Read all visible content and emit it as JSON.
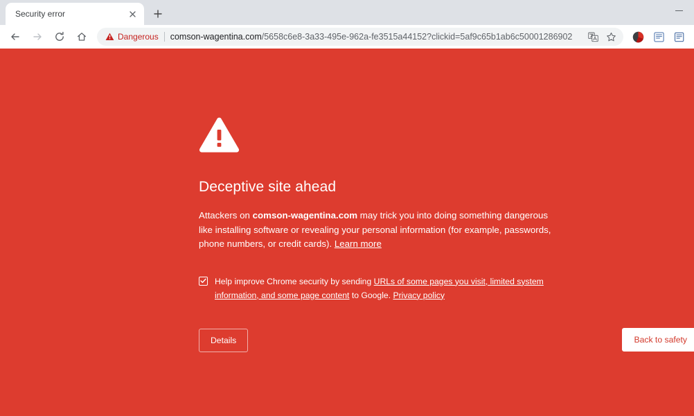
{
  "browser": {
    "tab": {
      "title": "Security error",
      "close_icon": "close-icon"
    },
    "new_tab_label": "+",
    "window_controls": {
      "minimize_label": "Minimize"
    },
    "nav": {
      "back_label": "Back",
      "forward_label": "Forward",
      "reload_label": "Reload",
      "home_label": "Home"
    },
    "omnibox": {
      "security_chip": "Dangerous",
      "security_icon": "warning-triangle-icon",
      "url_host": "comson-wagentina.com",
      "url_path": "/5658c6e8-3a33-495e-962a-fe3515a44152?clickid=5af9c65b1ab6c50001286902",
      "translate_icon": "translate-icon",
      "bookmark_icon": "star-icon"
    },
    "toolbar_extensions": [
      {
        "name": "profile-avatar-icon"
      },
      {
        "name": "reading-list-icon"
      },
      {
        "name": "extension-icon"
      }
    ]
  },
  "interstitial": {
    "icon": "warning-triangle-icon",
    "title": "Deceptive site ahead",
    "body_before": "Attackers on ",
    "body_host": "comson-wagentina.com",
    "body_after": " may trick you into doing something dangerous like installing software or revealing your personal information (for example, passwords, phone numbers, or credit cards). ",
    "learn_more": "Learn more",
    "optin": {
      "checked": true,
      "text_before": "Help improve Chrome security by sending ",
      "link_main": "URLs of some pages you visit, limited system information, and some page content",
      "text_middle": " to Google. ",
      "link_privacy": "Privacy policy"
    },
    "buttons": {
      "details": "Details",
      "back_to_safety": "Back to safety"
    }
  },
  "colors": {
    "interstitial_red": "#dd3c2f",
    "danger_text": "#c5221f",
    "tabstrip": "#dee1e6"
  }
}
